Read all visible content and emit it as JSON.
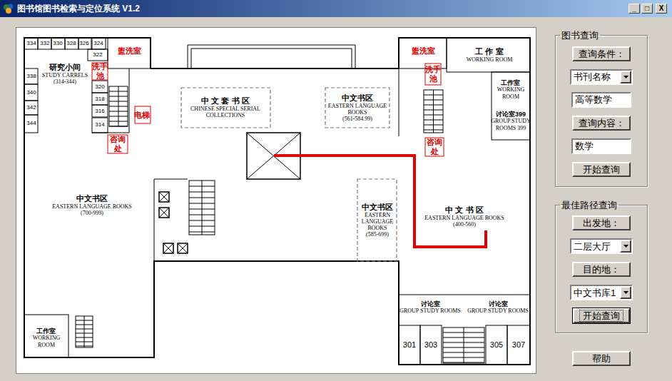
{
  "window": {
    "title": "图书馆图书检索与定位系统 V1.2",
    "controls": [
      "_",
      "□",
      "X"
    ]
  },
  "book_search": {
    "title": "图书查询",
    "condition_button": "查询条件：",
    "condition_field": "书刊名称",
    "condition_value": "高等数学",
    "content_button": "查询内容：",
    "content_value": "数学",
    "search_button": "开始查询"
  },
  "route_search": {
    "title": "最佳路径查询",
    "from_button": "出发地：",
    "from_value": "二层大厅",
    "to_button": "目的地：",
    "to_value": "中文书库1",
    "search_button": "开始查询",
    "search_focused": true
  },
  "help_button": "帮助",
  "map": {
    "route_visible": true,
    "labels": [
      {
        "kind": "room",
        "lines": [
          "334"
        ],
        "color": "#000000"
      },
      {
        "kind": "room",
        "lines": [
          "332"
        ],
        "color": "#000000"
      },
      {
        "kind": "room",
        "lines": [
          "330"
        ],
        "color": "#000000"
      },
      {
        "kind": "room",
        "lines": [
          "328"
        ],
        "color": "#000000"
      },
      {
        "kind": "room",
        "lines": [
          "326"
        ],
        "color": "#000000"
      },
      {
        "kind": "room",
        "lines": [
          "324"
        ],
        "color": "#000000"
      },
      {
        "kind": "room",
        "lines": [
          "322"
        ],
        "color": "#000000"
      },
      {
        "kind": "room",
        "lines": [
          "320"
        ],
        "color": "#000000"
      },
      {
        "kind": "room",
        "lines": [
          "318"
        ],
        "color": "#000000"
      },
      {
        "kind": "room",
        "lines": [
          "316"
        ],
        "color": "#000000"
      },
      {
        "kind": "room",
        "lines": [
          "314"
        ],
        "color": "#000000"
      },
      {
        "kind": "room",
        "lines": [
          "338"
        ],
        "color": "#000000"
      },
      {
        "kind": "room",
        "lines": [
          "340"
        ],
        "color": "#000000"
      },
      {
        "kind": "room",
        "lines": [
          "342"
        ],
        "color": "#000000"
      },
      {
        "kind": "room",
        "lines": [
          "344"
        ],
        "color": "#000000"
      },
      {
        "kind": "area",
        "lines": [
          "研究小间",
          "STUDY CARRELS",
          "(314-344)"
        ],
        "color": "#000000"
      },
      {
        "kind": "facility",
        "lines": [
          "盥洗室"
        ],
        "color": "#e00000"
      },
      {
        "kind": "facility",
        "lines": [
          "洗手池"
        ],
        "color": "#e00000"
      },
      {
        "kind": "facility",
        "lines": [
          "电梯"
        ],
        "color": "#e00000"
      },
      {
        "kind": "facility",
        "lines": [
          "咨询处"
        ],
        "color": "#e00000"
      },
      {
        "kind": "area",
        "lines": [
          "中 文 套 书 区",
          "CHINESE SPECIAL SERIAL",
          "COLLECTIONS"
        ],
        "color": "#000000"
      },
      {
        "kind": "area",
        "lines": [
          "中文书区",
          "EASTERN LANGUAGE",
          "BOOKS",
          "(561-584.99)"
        ],
        "color": "#000000"
      },
      {
        "kind": "facility",
        "lines": [
          "盥洗室"
        ],
        "color": "#e00000"
      },
      {
        "kind": "area",
        "lines": [
          "工 作 室",
          "WORKING ROOM"
        ],
        "color": "#000000"
      },
      {
        "kind": "facility",
        "lines": [
          "洗手池"
        ],
        "color": "#e00000"
      },
      {
        "kind": "area-small",
        "lines": [
          "工作室",
          "WORKING",
          "ROOM"
        ],
        "color": "#000000"
      },
      {
        "kind": "area-small",
        "lines": [
          "讨论室399",
          "GROUP STUDY",
          "ROOMS 399"
        ],
        "color": "#000000"
      },
      {
        "kind": "facility",
        "lines": [
          "咨询处"
        ],
        "color": "#e00000"
      },
      {
        "kind": "area",
        "lines": [
          "中文书区",
          "EASTERN LANGUAGE BOOKS",
          "(700-999)"
        ],
        "color": "#000000"
      },
      {
        "kind": "area",
        "lines": [
          "中文书区",
          "EASTERN",
          "LANGUAGE",
          "BOOKS",
          "(585-699)"
        ],
        "color": "#000000"
      },
      {
        "kind": "area",
        "lines": [
          "中 文 书 区",
          "EASTERN LANGUAGE BOOKS",
          "(400-560)"
        ],
        "color": "#000000"
      },
      {
        "kind": "area-small",
        "lines": [
          "讨论室",
          "GROUP STUDY ROOMS"
        ],
        "color": "#000000"
      },
      {
        "kind": "area-small",
        "lines": [
          "讨论室",
          "GROUP STUDY ROOMS"
        ],
        "color": "#000000"
      },
      {
        "kind": "room-large",
        "lines": [
          "301"
        ],
        "color": "#000000"
      },
      {
        "kind": "room-large",
        "lines": [
          "303"
        ],
        "color": "#000000"
      },
      {
        "kind": "room-large",
        "lines": [
          "305"
        ],
        "color": "#000000"
      },
      {
        "kind": "room-large",
        "lines": [
          "307"
        ],
        "color": "#000000"
      },
      {
        "kind": "area-small",
        "lines": [
          "工作室",
          "WORKING",
          "ROOM"
        ],
        "color": "#000000"
      }
    ]
  }
}
